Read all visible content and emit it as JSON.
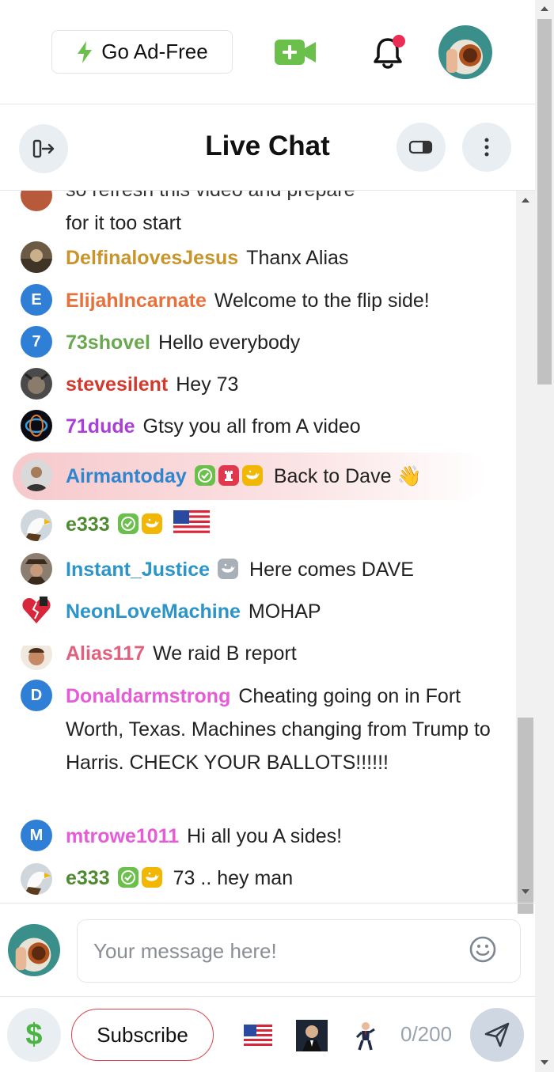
{
  "topbar": {
    "adfree_label": "Go Ad-Free",
    "icons": [
      "bolt-icon",
      "video-plus-icon",
      "bell-icon",
      "user-avatar"
    ]
  },
  "chat_header": {
    "title": "Live Chat",
    "icons": [
      "exit-icon",
      "theater-mode-icon",
      "more-vertical-icon"
    ]
  },
  "messages": [
    {
      "user": "",
      "text": "for it too start",
      "partial": true,
      "avatar": "photo"
    },
    {
      "user": "DelfinalovesJesus",
      "color": "#c8952a",
      "text": "Thanx Alias",
      "avatar": "photo"
    },
    {
      "user": "ElijahIncarnate",
      "color": "#e8703a",
      "text": "Welcome to the flip side!",
      "avatar": "E"
    },
    {
      "user": "73shovel",
      "color": "#6aa84f",
      "text": "Hello everybody",
      "avatar": "7"
    },
    {
      "user": "stevesilent",
      "color": "#d23a2e",
      "text": "Hey 73",
      "avatar": "photo"
    },
    {
      "user": "71dude",
      "color": "#a93fd6",
      "text": "Gtsy you all from A video",
      "avatar": "photo"
    },
    {
      "user": "Airmantoday",
      "color": "#2f86d0",
      "text": "Back to Dave 👋",
      "avatar": "photo",
      "highlighted": true,
      "badges": [
        "verified",
        "rank",
        "whale"
      ]
    },
    {
      "user": "e333",
      "color": "#4e8a2f",
      "text": "🇺🇸",
      "avatar": "photo",
      "badges": [
        "verified",
        "whale"
      ]
    },
    {
      "user": "Instant_Justice",
      "color": "#2b94c9",
      "text": "Here comes DAVE",
      "avatar": "photo",
      "badges": [
        "whale-grey"
      ]
    },
    {
      "user": "NeonLoveMachine",
      "color": "#2b94c9",
      "text": "MOHAP",
      "avatar": "photo"
    },
    {
      "user": "Alias117",
      "color": "#e0607e",
      "text": "We raid B report",
      "avatar": "photo"
    },
    {
      "user": "Donaldarmstrong",
      "color": "#e65bd8",
      "text": "Cheating going on in Fort Worth, Texas. Machines changing from Trump to Harris. CHECK YOUR BALLOTS!!!!!!",
      "avatar": "D"
    },
    {
      "user": "mtrowe1011",
      "color": "#e65bd8",
      "text": "Hi all you A sides!",
      "avatar": "M"
    },
    {
      "user": "e333",
      "color": "#4e8a2f",
      "text": "73 .. hey man",
      "avatar": "photo",
      "badges": [
        "verified",
        "whale"
      ]
    }
  ],
  "partial_top_text": "so refresh this video and prepare",
  "composer": {
    "placeholder": "Your message here!",
    "subscribe_label": "Subscribe",
    "tip_symbol": "$",
    "counter": "0/200",
    "quick_emotes": [
      "us-flag-emote",
      "tuxedo-man-emote",
      "dancing-man-emote"
    ]
  }
}
